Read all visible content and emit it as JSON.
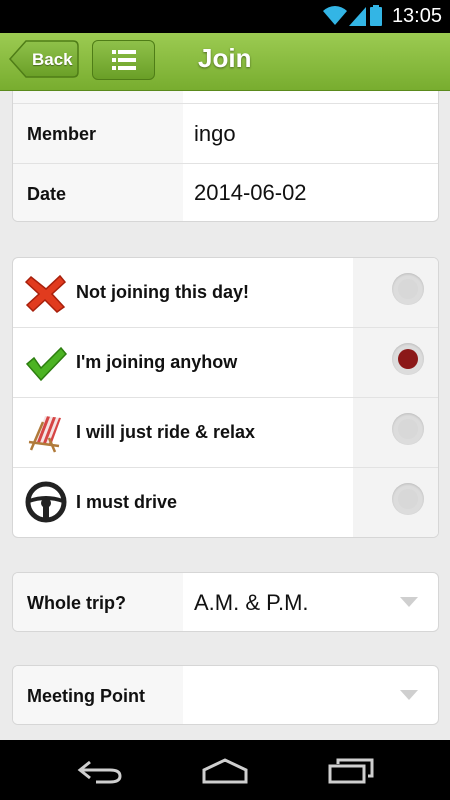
{
  "status_bar": {
    "time": "13:05",
    "icons": [
      "wifi-icon",
      "signal-icon",
      "battery-icon"
    ]
  },
  "header": {
    "back_label": "Back",
    "title": "Join",
    "menu_icon": "list-icon"
  },
  "info": {
    "rows": [
      {
        "label": "Member",
        "value": "ingo"
      },
      {
        "label": "Date",
        "value": "2014-06-02"
      }
    ]
  },
  "choices": [
    {
      "label": "Not joining this day!",
      "icon": "red-x-icon",
      "selected": false
    },
    {
      "label": "I'm joining anyhow",
      "icon": "green-check-icon",
      "selected": true
    },
    {
      "label": "I will just ride & relax",
      "icon": "deck-chair-icon",
      "selected": false
    },
    {
      "label": "I must drive",
      "icon": "steering-wheel-icon",
      "selected": false
    }
  ],
  "trip": {
    "label": "Whole trip?",
    "value": "A.M. & P.M."
  },
  "meeting": {
    "label": "Meeting Point",
    "value": ""
  },
  "colors": {
    "header_green": "#8cbf44",
    "radio_selected": "#8b1818"
  }
}
